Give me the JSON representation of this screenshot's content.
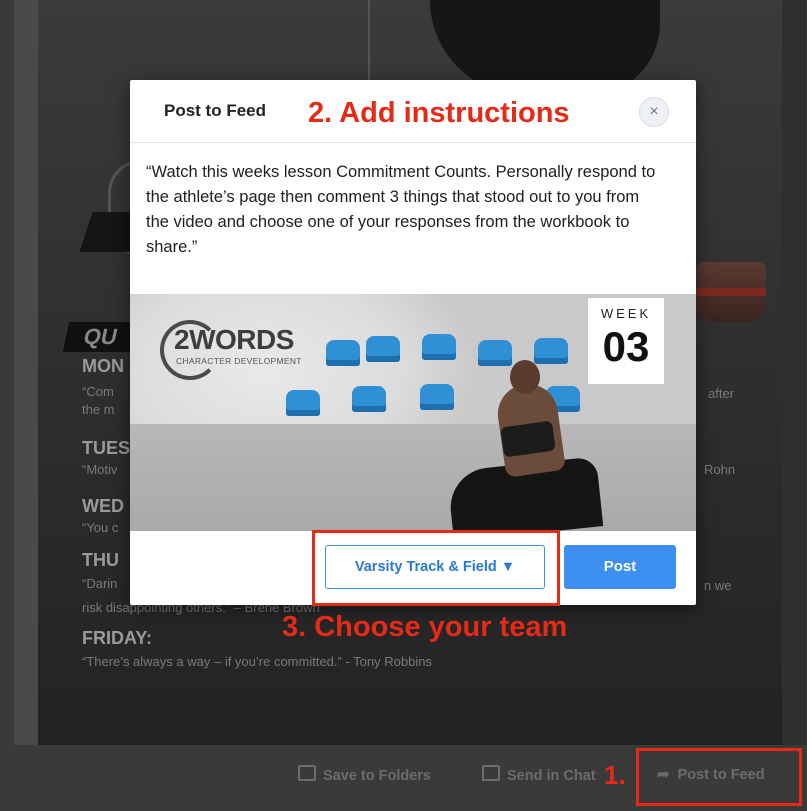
{
  "background": {
    "quotes_heading": "QU",
    "days": [
      {
        "label": "MON",
        "line": "“Com",
        "line2": "the m",
        "tail": "after"
      },
      {
        "label": "TUES",
        "line": "“Motiv",
        "tail": "Rohn"
      },
      {
        "label": "WED",
        "line": "“You c"
      },
      {
        "label": "THU",
        "line": "“Darin",
        "line2": "risk disappointing others.” – Brene Brown",
        "tail": "n we"
      },
      {
        "label": "FRIDAY:",
        "line": "“There’s always a way – if you’re committed.” - Tony Robbins"
      }
    ]
  },
  "modal": {
    "title": "Post to Feed",
    "close_glyph": "×",
    "instructions": "“Watch this weeks lesson Commitment Counts. Personally respond to the athlete’s page then comment 3 things that stood out to you from the video and choose one of your responses from the workbook to share.”",
    "thumbnail": {
      "logo_text": "2WORDS",
      "logo_sub": "CHARACTER DEVELOPMENT",
      "week_label": "WEEK",
      "week_number": "03"
    },
    "team_select": {
      "label": "Varsity Track & Field ▼"
    },
    "post_label": "Post"
  },
  "annotations": {
    "step1": "1.",
    "step2": "2. Add instructions",
    "step3": "3. Choose your team",
    "color": "#e62a18"
  },
  "actions": {
    "save_to_folders": "Save to Folders",
    "send_in_chat": "Send in Chat",
    "post_to_feed": "Post to Feed"
  },
  "colors": {
    "accent_blue": "#3e8ff2",
    "annotation_red": "#e62a18"
  }
}
